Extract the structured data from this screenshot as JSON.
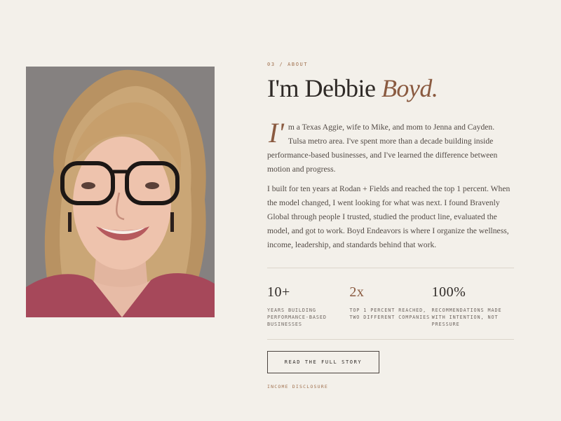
{
  "about": {
    "eyebrow": "03 / ABOUT",
    "heading_main": "I'm Debbie ",
    "heading_accent": "Boyd.",
    "dropcap": "I'",
    "intro_text": "m a Texas Aggie, wife to Mike, and mom to Jenna and Cayden. Tulsa metro area. I've spent more than a decade building inside performance-based businesses, and I've learned the difference between motion and progress.",
    "body_text": "I built for ten years at Rodan + Fields and reached the top 1 percent. When the model changed, I went looking for what was next. I found Bravenly Global through people I trusted, studied the product line, evaluated the model, and got to work. Boyd Endeavors is where I organize the wellness, income, leadership, and standards behind that work.",
    "portrait_alt": "Portrait of Debbie Boyd"
  },
  "stats": [
    {
      "number_main": "10+",
      "number_accent": "",
      "label": "YEARS BUILDING PERFORMANCE-BASED BUSINESSES"
    },
    {
      "number_main": "",
      "number_accent": "2x",
      "label": "TOP 1 PERCENT REACHED, TWO DIFFERENT COMPANIES"
    },
    {
      "number_main": "100%",
      "number_accent": "",
      "label": "RECOMMENDATIONS MADE WITH INTENTION, NOT PRESSURE"
    }
  ],
  "cta": {
    "label": "READ THE FULL STORY"
  },
  "disclosure": {
    "label": "INCOME DISCLOSURE"
  },
  "colors": {
    "background": "#f3f0ea",
    "accent": "#8a5a40",
    "eyebrow": "#a0714f",
    "text": "#2f2a27"
  }
}
